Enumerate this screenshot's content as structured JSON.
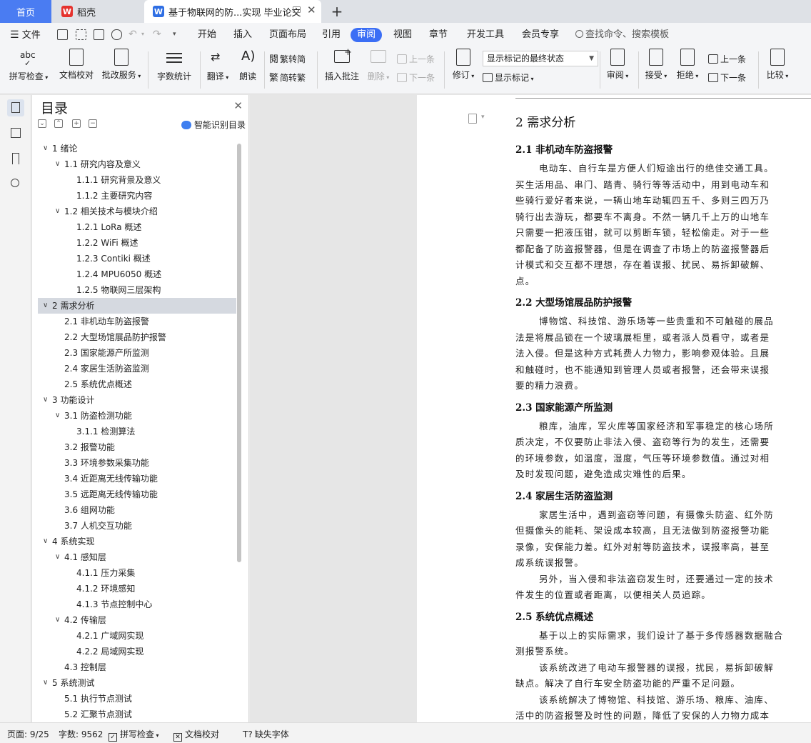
{
  "tabs": {
    "home": "首页",
    "wps": "稻壳",
    "doc": "基于物联网的防...实现 毕业论文",
    "new_tab": "+"
  },
  "menu": {
    "file": "文件",
    "items": [
      "开始",
      "插入",
      "页面布局",
      "引用",
      "审阅",
      "视图",
      "章节",
      "开发工具",
      "会员专享"
    ],
    "active": "审阅",
    "search": "查找命令、搜索模板"
  },
  "ribbon": {
    "spell_check": "拼写检查",
    "doc_proof": "文档校对",
    "batch_service": "批改服务",
    "word_count": "字数统计",
    "translate": "翻译",
    "read_aloud": "朗读",
    "trad_to_simp": "繁转简",
    "simp_to_trad": "简转繁",
    "insert_comment": "插入批注",
    "delete": "删除",
    "prev_comment": "上一条",
    "next_comment": "下一条",
    "track_changes": "修订",
    "markup_state": "显示标记的最终状态",
    "show_markup": "显示标记",
    "review": "审阅",
    "accept": "接受",
    "reject": "拒绝",
    "prev_change": "上一条",
    "next_change": "下一条",
    "compare": "比较"
  },
  "toc": {
    "title": "目录",
    "smart": "智能识别目录",
    "items": [
      {
        "text": "1  绪论",
        "level": 0,
        "expand": true
      },
      {
        "text": "1.1  研究内容及意义",
        "level": 1,
        "expand": true
      },
      {
        "text": "1.1.1  研究背景及意义",
        "level": 2,
        "expand": false
      },
      {
        "text": "1.1.2  主要研究内容",
        "level": 2,
        "expand": false
      },
      {
        "text": "1.2  相关技术与模块介绍",
        "level": 1,
        "expand": true
      },
      {
        "text": "1.2.1 LoRa 概述",
        "level": 2,
        "expand": false
      },
      {
        "text": "1.2.2 WiFi 概述",
        "level": 2,
        "expand": false
      },
      {
        "text": "1.2.3 Contiki 概述",
        "level": 2,
        "expand": false
      },
      {
        "text": "1.2.4 MPU6050 概述",
        "level": 2,
        "expand": false
      },
      {
        "text": "1.2.5  物联网三层架构",
        "level": 2,
        "expand": false
      },
      {
        "text": "2  需求分析",
        "level": 0,
        "expand": true,
        "selected": true
      },
      {
        "text": "2.1 非机动车防盗报警",
        "level": 1,
        "expand": false
      },
      {
        "text": "2.2  大型场馆展品防护报警",
        "level": 1,
        "expand": false
      },
      {
        "text": "2.3  国家能源产所监测",
        "level": 1,
        "expand": false
      },
      {
        "text": "2.4  家居生活防盗监测",
        "level": 1,
        "expand": false
      },
      {
        "text": "2.5  系统优点概述",
        "level": 1,
        "expand": false
      },
      {
        "text": "3  功能设计",
        "level": 0,
        "expand": true
      },
      {
        "text": "3.1  防盗检测功能",
        "level": 1,
        "expand": true
      },
      {
        "text": "3.1.1  检测算法",
        "level": 2,
        "expand": false
      },
      {
        "text": "3.2  报警功能",
        "level": 1,
        "expand": false
      },
      {
        "text": "3.3  环境参数采集功能",
        "level": 1,
        "expand": false
      },
      {
        "text": "3.4  近距离无线传输功能",
        "level": 1,
        "expand": false
      },
      {
        "text": "3.5  远距离无线传输功能",
        "level": 1,
        "expand": false
      },
      {
        "text": "3.6  组网功能",
        "level": 1,
        "expand": false
      },
      {
        "text": "3.7  人机交互功能",
        "level": 1,
        "expand": false
      },
      {
        "text": "4  系统实现",
        "level": 0,
        "expand": true
      },
      {
        "text": "4.1  感知层",
        "level": 1,
        "expand": true
      },
      {
        "text": "4.1.1  压力采集",
        "level": 2,
        "expand": false
      },
      {
        "text": "4.1.2  环境感知",
        "level": 2,
        "expand": false
      },
      {
        "text": "4.1.3  节点控制中心",
        "level": 2,
        "expand": false
      },
      {
        "text": "4.2  传输层",
        "level": 1,
        "expand": true
      },
      {
        "text": "4.2.1  广域网实现",
        "level": 2,
        "expand": false
      },
      {
        "text": "4.2.2  局域网实现",
        "level": 2,
        "expand": false
      },
      {
        "text": "4.3  控制层",
        "level": 1,
        "expand": false
      },
      {
        "text": "5  系统测试",
        "level": 0,
        "expand": true
      },
      {
        "text": "5.1  执行节点测试",
        "level": 1,
        "expand": false
      },
      {
        "text": "5.2  汇聚节点测试",
        "level": 1,
        "expand": false
      }
    ]
  },
  "doc": {
    "blocks": [
      {
        "kind": "h1",
        "lines": [
          "2  需求分析"
        ]
      },
      {
        "kind": "h2",
        "lines": [
          "2.1 非机动车防盗报警"
        ]
      },
      {
        "kind": "p",
        "lines": [
          {
            "t": "电动车、自行车是方便人们短途出行的绝佳交通工具。",
            "ind": true
          },
          {
            "t": "买生活用品、串门、踏青、骑行等等活动中，用到电动车和",
            "ind": false
          },
          {
            "t": "些骑行爱好者来说，一辆山地车动辄四五千、多则三四万乃",
            "ind": false
          },
          {
            "t": "骑行出去游玩，都要车不离身。不然一辆几千上万的山地车",
            "ind": false
          },
          {
            "t": "只需要一把液压钳，就可以剪断车锁，轻松偷走。对于一些",
            "ind": false
          },
          {
            "t": "都配备了防盗报警器，但是在调查了市场上的防盗报警器后",
            "ind": false
          },
          {
            "t": "计模式和交互都不理想，存在着误报、扰民、易拆卸破解、",
            "ind": false
          },
          {
            "t": "点。",
            "ind": false
          }
        ]
      },
      {
        "kind": "h2",
        "lines": [
          "2.2  大型场馆展品防护报警"
        ]
      },
      {
        "kind": "p",
        "lines": [
          {
            "t": "博物馆、科技馆、游乐场等一些贵重和不可触碰的展品",
            "ind": true
          },
          {
            "t": "法是将展品锁在一个玻璃展柜里，或者派人员看守，或者是",
            "ind": false
          },
          {
            "t": "法入侵。但是这种方式耗费人力物力，影响参观体验。且展",
            "ind": false
          },
          {
            "t": "和触碰时，也不能通知到管理人员或者报警，还会带来误报",
            "ind": false
          },
          {
            "t": "要的精力浪费。",
            "ind": false
          }
        ]
      },
      {
        "kind": "h2",
        "lines": [
          "2.3  国家能源产所监测"
        ]
      },
      {
        "kind": "p",
        "lines": [
          {
            "t": "粮库，油库，军火库等国家经济和军事稳定的核心场所",
            "ind": true
          },
          {
            "t": "质决定，不仅要防止非法入侵、盗窃等行为的发生，还需要",
            "ind": false
          },
          {
            "t": "的环境参数，如温度，湿度，气压等环境参数值。通过对相",
            "ind": false
          },
          {
            "t": "及时发现问题，避免造成灾难性的后果。",
            "ind": false
          }
        ]
      },
      {
        "kind": "h2",
        "lines": [
          "2.4  家居生活防盗监测"
        ]
      },
      {
        "kind": "p",
        "lines": [
          {
            "t": "家居生活中，遇到盗窃等问题，有摄像头防盗、红外防",
            "ind": true
          },
          {
            "t": "但摄像头的能耗、架设成本较高，且无法做到防盗报警功能",
            "ind": false
          },
          {
            "t": "录像，安保能力差。红外对射等防盗技术，误报率高，甚至",
            "ind": false
          },
          {
            "t": "成系统误报警。",
            "ind": false
          },
          {
            "t": "另外，当入侵和非法盗窃发生时，还要通过一定的技术",
            "ind": true
          },
          {
            "t": "件发生的位置或者距离，以便相关人员追踪。",
            "ind": false
          }
        ]
      },
      {
        "kind": "h2",
        "lines": [
          "2.5  系统优点概述"
        ]
      },
      {
        "kind": "p",
        "lines": [
          {
            "t": "基于以上的实际需求，我们设计了基于多传感器数据融合",
            "ind": true
          },
          {
            "t": "测报警系统。",
            "ind": false
          },
          {
            "t": "该系统改进了电动车报警器的误报，扰民，易拆卸破解",
            "ind": true
          },
          {
            "t": "缺点。解决了自行车安全防盗功能的严重不足问题。",
            "ind": false
          },
          {
            "t": "该系统解决了博物馆、科技馆、游乐场、粮库、油库、",
            "ind": true
          },
          {
            "t": "活中的防盗报警及时性的问题，降低了安保的人力物力成本",
            "ind": false
          }
        ]
      }
    ]
  },
  "status": {
    "page": "页面: 9/25",
    "words": "字数: 9562",
    "spell": "拼写检查",
    "proof": "文档校对",
    "missing_font": "缺失字体"
  },
  "colors": {
    "accent": "#3b6ef5",
    "home_tab": "#4a7cf2",
    "wps_logo": "#e5322d",
    "doc_logo": "#2f6fe4"
  }
}
